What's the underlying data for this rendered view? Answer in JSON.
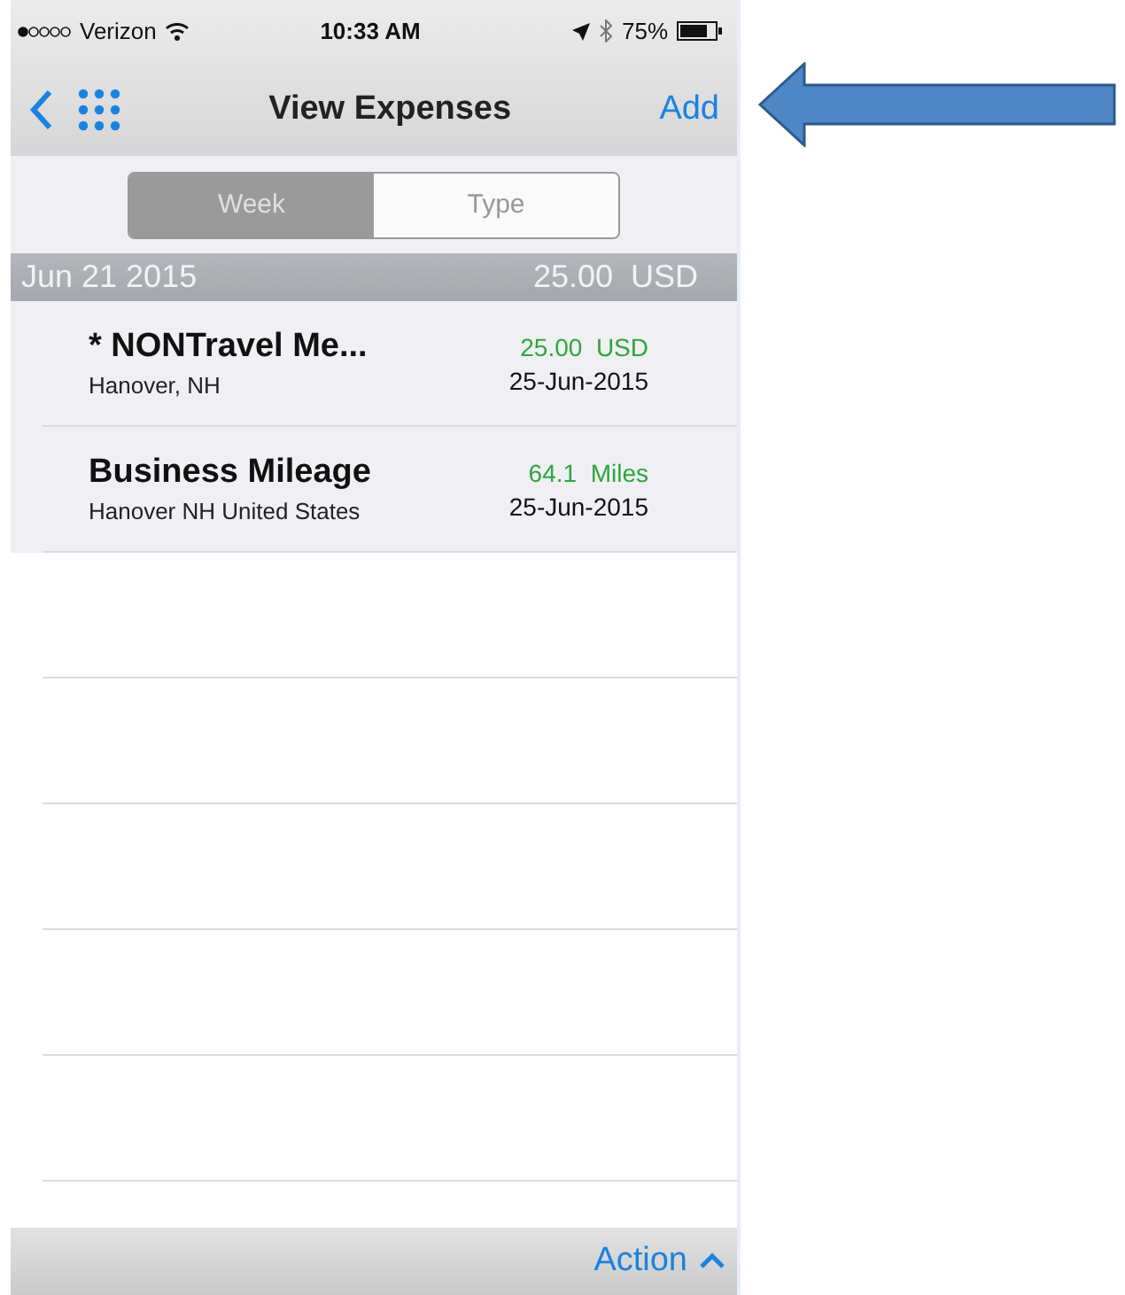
{
  "status_bar": {
    "carrier": "Verizon",
    "time": "10:33 AM",
    "battery": "75%"
  },
  "nav_bar": {
    "title": "View Expenses",
    "add": "Add"
  },
  "tabs": [
    {
      "label": "Week",
      "selected": true
    },
    {
      "label": "Type",
      "selected": false
    }
  ],
  "section": {
    "date": "Jun 21 2015",
    "total": "25.00  USD"
  },
  "expenses": [
    {
      "title": "* NONTravel Me...",
      "location": "Hanover, NH",
      "amount": "25.00  USD",
      "date": "25-Jun-2015"
    },
    {
      "title": "Business Mileage",
      "location": "Hanover NH United States",
      "amount": "64.1  Miles",
      "date": "25-Jun-2015"
    }
  ],
  "toolbar": {
    "action": "Action"
  }
}
